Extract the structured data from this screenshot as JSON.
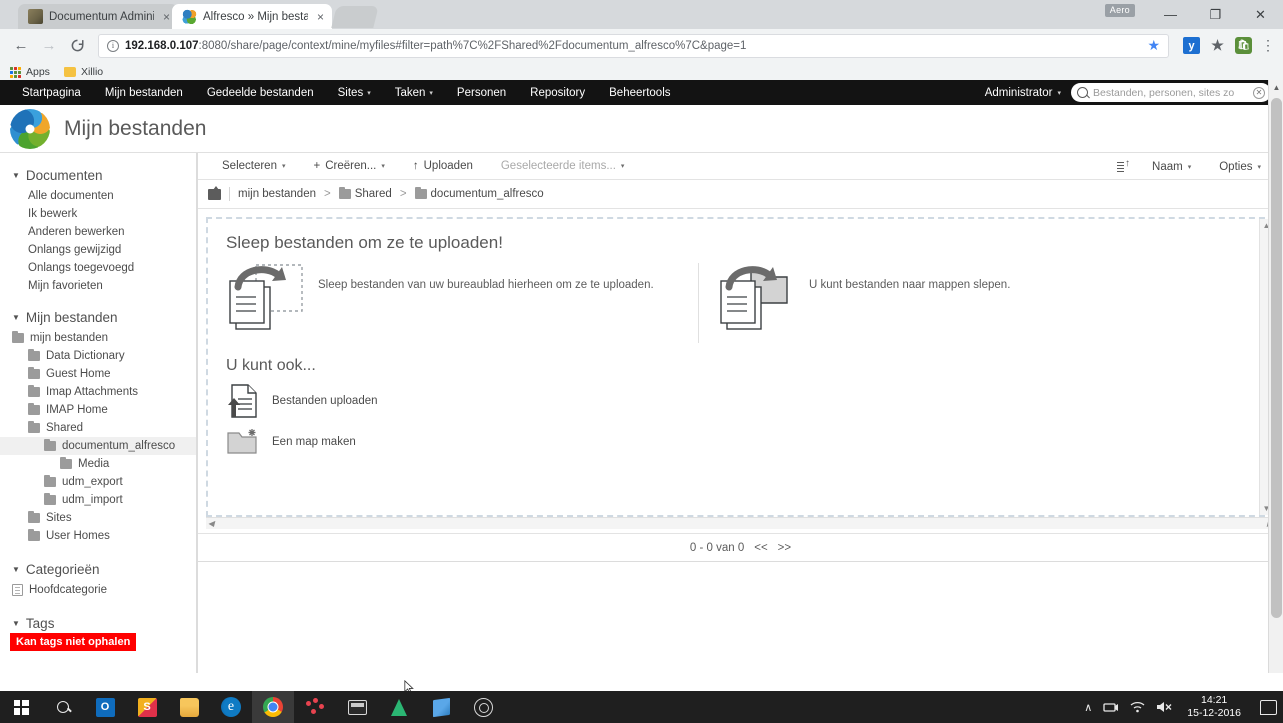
{
  "browser": {
    "tabs": [
      {
        "title": "Documentum Administra",
        "favicon": "documentum-favicon",
        "active": false
      },
      {
        "title": "Alfresco » Mijn bestande",
        "favicon": "alfresco-favicon",
        "active": true
      }
    ],
    "close_label": "×",
    "aero_badge": "Aero",
    "window_controls": {
      "minimize": "—",
      "maximize": "❐",
      "close": "✕"
    },
    "nav": {
      "back": "←",
      "forward": "→",
      "reload": "C"
    },
    "url": {
      "host": "192.168.0.107",
      "rest": ":8080/share/page/context/mine/myfiles#filter=path%7C%2FShared%2Fdocumentum_alfresco%7C&page=1"
    },
    "star": "★",
    "extensions": [
      "yandex-extension-icon",
      "pinned-extension-icon",
      "shopping-extension-icon"
    ],
    "menu": "⋮",
    "bookmarks": [
      {
        "label": "Apps",
        "icon": "apps-grid-icon"
      },
      {
        "label": "Xillio",
        "icon": "folder-icon"
      }
    ]
  },
  "alfresco": {
    "nav_items": [
      {
        "label": "Startpagina",
        "has_caret": false
      },
      {
        "label": "Mijn bestanden",
        "has_caret": false
      },
      {
        "label": "Gedeelde bestanden",
        "has_caret": false
      },
      {
        "label": "Sites",
        "has_caret": true
      },
      {
        "label": "Taken",
        "has_caret": true
      },
      {
        "label": "Personen",
        "has_caret": false
      },
      {
        "label": "Repository",
        "has_caret": false
      },
      {
        "label": "Beheertools",
        "has_caret": false
      }
    ],
    "user": "Administrator",
    "user_caret": "▾",
    "search_placeholder": "Bestanden, personen, sites zo",
    "search_value": "",
    "page_title": "Mijn bestanden"
  },
  "sidebar": {
    "documents_section": {
      "label": "Documenten",
      "items": [
        "Alle documenten",
        "Ik bewerk",
        "Anderen bewerken",
        "Onlangs gewijzigd",
        "Onlangs toegevoegd",
        "Mijn favorieten"
      ]
    },
    "myfiles_section": {
      "label": "Mijn bestanden",
      "tree": [
        {
          "label": "mijn bestanden",
          "indent": 0,
          "selected": false
        },
        {
          "label": "Data Dictionary",
          "indent": 1,
          "selected": false
        },
        {
          "label": "Guest Home",
          "indent": 1,
          "selected": false
        },
        {
          "label": "Imap Attachments",
          "indent": 1,
          "selected": false
        },
        {
          "label": "IMAP Home",
          "indent": 1,
          "selected": false
        },
        {
          "label": "Shared",
          "indent": 1,
          "selected": false
        },
        {
          "label": "documentum_alfresco",
          "indent": 2,
          "selected": true
        },
        {
          "label": "Media",
          "indent": 3,
          "selected": false
        },
        {
          "label": "udm_export",
          "indent": 2,
          "selected": false
        },
        {
          "label": "udm_import",
          "indent": 2,
          "selected": false
        },
        {
          "label": "Sites",
          "indent": 1,
          "selected": false
        },
        {
          "label": "User Homes",
          "indent": 1,
          "selected": false
        }
      ]
    },
    "categories_section": {
      "label": "Categorieën",
      "item": "Hoofdcategorie"
    },
    "tags_section": {
      "label": "Tags",
      "error": "Kan tags niet ophalen"
    }
  },
  "toolbar": {
    "select": "Selecteren",
    "create": "Creëren...",
    "upload": "Uploaden",
    "selected_items": "Geselecteerde items...",
    "sort_icon": "sort-ascending-icon",
    "sort_field": "Naam",
    "options": "Opties",
    "caret": "▾",
    "plus": "+",
    "upload_arrow": "↑"
  },
  "breadcrumb": {
    "up_icon": "up-folder-icon",
    "crumbs": [
      "mijn bestanden",
      "Shared",
      "documentum_alfresco"
    ],
    "separator": ">"
  },
  "dropzone": {
    "heading": "Sleep bestanden om ze te uploaden!",
    "left_text": "Sleep bestanden van uw bureaublad hierheen om ze te uploaden.",
    "right_text": "U kunt bestanden naar mappen slepen.",
    "also_heading": "U kunt ook...",
    "actions": [
      {
        "label": "Bestanden uploaden",
        "icon": "upload-document-icon"
      },
      {
        "label": "Een map maken",
        "icon": "new-folder-icon"
      }
    ]
  },
  "pagination": {
    "range": "0 - 0 van 0",
    "prev": "<<",
    "next": ">>"
  },
  "statusbar": {
    "text": ""
  },
  "taskbar": {
    "items": [
      {
        "name": "start-button",
        "icon": "windows-logo-icon"
      },
      {
        "name": "search-button",
        "icon": "search-icon"
      },
      {
        "name": "outlook-button",
        "icon": "outlook-icon",
        "label": "O"
      },
      {
        "name": "skype-button",
        "icon": "skype-business-icon",
        "label": "S"
      },
      {
        "name": "file-explorer-button",
        "icon": "folder-icon"
      },
      {
        "name": "edge-button",
        "icon": "edge-icon",
        "label": "e"
      },
      {
        "name": "chrome-button",
        "icon": "chrome-icon",
        "active": true
      },
      {
        "name": "hubspot-button",
        "icon": "dots-icon"
      },
      {
        "name": "terminal-button",
        "icon": "terminal-icon"
      },
      {
        "name": "sourcetree-button",
        "icon": "green-drop-icon"
      },
      {
        "name": "app-button",
        "icon": "blue-page-icon"
      },
      {
        "name": "obs-button",
        "icon": "circle-icon"
      }
    ],
    "tray": {
      "chevron": "∧",
      "network": "network-icon",
      "wifi": "wifi-icon",
      "volume": "volume-muted-icon",
      "time": "14:21",
      "date": "15-12-2016",
      "action_center": "notification-icon"
    }
  }
}
